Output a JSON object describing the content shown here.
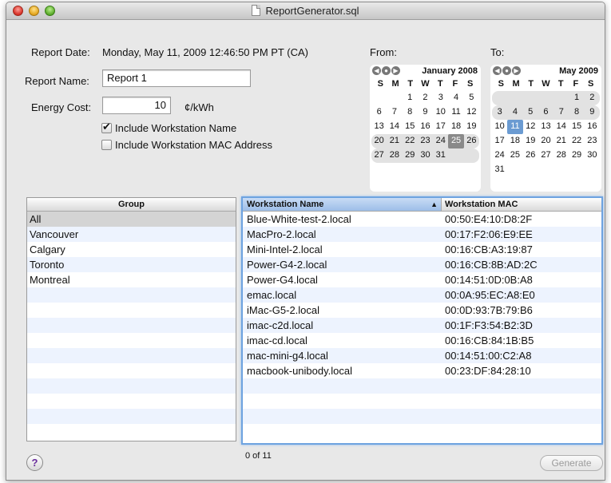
{
  "window": {
    "title": "ReportGenerator.sql"
  },
  "report": {
    "date_label": "Report Date:",
    "date_value": "Monday, May 11, 2009 12:46:50 PM PT (CA)",
    "name_label": "Report Name:",
    "name_value": "Report 1",
    "cost_label": "Energy Cost:",
    "cost_value": "10",
    "cost_unit": "¢/kWh",
    "include_name_label": "Include Workstation Name",
    "include_name_checked": true,
    "include_mac_label": "Include Workstation MAC Address",
    "include_mac_checked": false
  },
  "from_cal": {
    "label": "From:",
    "month": "January 2008",
    "dow": [
      "S",
      "M",
      "T",
      "W",
      "T",
      "F",
      "S"
    ],
    "weeks": [
      [
        "",
        "",
        "1",
        "2",
        "3",
        "4",
        "5"
      ],
      [
        "6",
        "7",
        "8",
        "9",
        "10",
        "11",
        "12"
      ],
      [
        "13",
        "14",
        "15",
        "16",
        "17",
        "18",
        "19"
      ],
      [
        "20",
        "21",
        "22",
        "23",
        "24",
        "25",
        "26"
      ],
      [
        "27",
        "28",
        "29",
        "30",
        "31",
        "",
        ""
      ]
    ],
    "selected_day": "25"
  },
  "to_cal": {
    "label": "To:",
    "month": "May 2009",
    "dow": [
      "S",
      "M",
      "T",
      "W",
      "T",
      "F",
      "S"
    ],
    "weeks": [
      [
        "",
        "",
        "",
        "",
        "",
        "1",
        "2"
      ],
      [
        "3",
        "4",
        "5",
        "6",
        "7",
        "8",
        "9"
      ],
      [
        "10",
        "11",
        "12",
        "13",
        "14",
        "15",
        "16"
      ],
      [
        "17",
        "18",
        "19",
        "20",
        "21",
        "22",
        "23"
      ],
      [
        "24",
        "25",
        "26",
        "27",
        "28",
        "29",
        "30"
      ],
      [
        "31",
        "",
        "",
        "",
        "",
        "",
        ""
      ]
    ],
    "today_day": "11"
  },
  "groups": {
    "header": "Group",
    "items": [
      "All",
      "Vancouver",
      "Calgary",
      "Toronto",
      "Montreal"
    ],
    "selected_index": 0,
    "total_rows": 15
  },
  "workstations": {
    "col_name": "Workstation Name",
    "col_mac": "Workstation MAC",
    "sort_arrow": "▲",
    "rows": [
      {
        "name": "Blue-White-test-2.local",
        "mac": "00:50:E4:10:D8:2F"
      },
      {
        "name": "MacPro-2.local",
        "mac": "00:17:F2:06:E9:EE"
      },
      {
        "name": "Mini-Intel-2.local",
        "mac": "00:16:CB:A3:19:87"
      },
      {
        "name": "Power-G4-2.local",
        "mac": "00:16:CB:8B:AD:2C"
      },
      {
        "name": "Power-G4.local",
        "mac": "00:14:51:0D:0B:A8"
      },
      {
        "name": "emac.local",
        "mac": "00:0A:95:EC:A8:E0"
      },
      {
        "name": "iMac-G5-2.local",
        "mac": "00:0D:93:7B:79:B6"
      },
      {
        "name": "imac-c2d.local",
        "mac": "00:1F:F3:54:B2:3D"
      },
      {
        "name": "imac-cd.local",
        "mac": "00:16:CB:84:1B:B5"
      },
      {
        "name": "mac-mini-g4.local",
        "mac": "00:14:51:00:C2:A8"
      },
      {
        "name": "macbook-unibody.local",
        "mac": "00:23:DF:84:28:10"
      }
    ],
    "total_rows": 15,
    "count_text": "0 of 11"
  },
  "buttons": {
    "help": "?",
    "generate": "Generate"
  }
}
